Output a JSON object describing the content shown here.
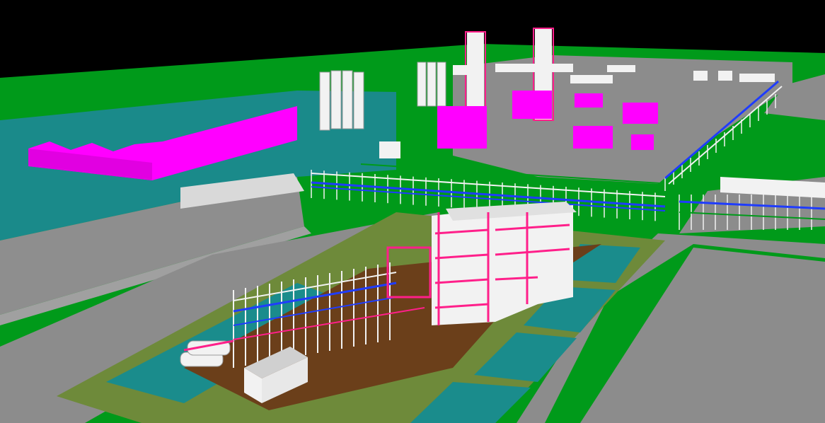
{
  "scene": {
    "type": "3d-plant-model-viewport",
    "visible_text": [],
    "colors": {
      "sky": "#000000",
      "grass": "#009a1a",
      "road": "#8c8c8c",
      "water_basin": "#1a8c8c",
      "basin_edge": "#6e8a3a",
      "dirt_pad": "#6b3f1a",
      "equipment_magenta": "#ff00ff",
      "pipe_pink": "#ff1f8a",
      "pipe_blue": "#1f3cff",
      "steel_white": "#f2f2f2",
      "building_grey": "#dcdcdc"
    }
  }
}
